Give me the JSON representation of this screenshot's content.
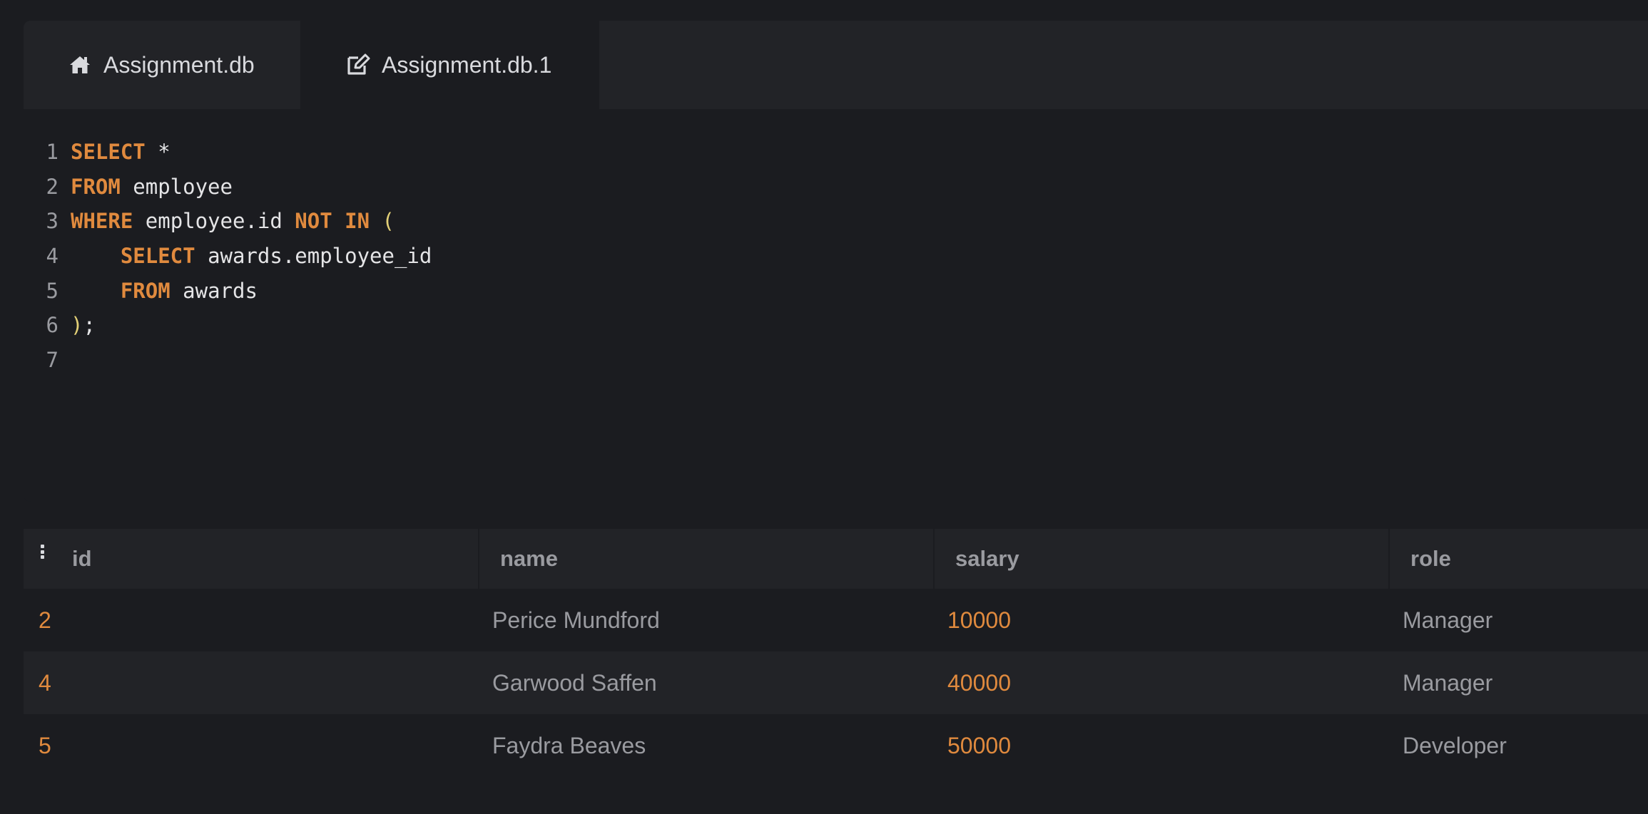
{
  "tabs": [
    {
      "label": "Assignment.db",
      "icon": "home-icon"
    },
    {
      "label": "Assignment.db.1",
      "icon": "edit-icon"
    }
  ],
  "editor": {
    "line_numbers": [
      "1",
      "2",
      "3",
      "4",
      "5",
      "6",
      "7"
    ],
    "tokens": {
      "l1_kw": "SELECT",
      "l1_rest": " *",
      "l2_kw": "FROM",
      "l2_rest": " employee",
      "l3_kw": "WHERE",
      "l3_mid": " employee.id ",
      "l3_kw2": "NOT IN",
      "l3_paren": "(",
      "l4_indent": "    ",
      "l4_kw": "SELECT",
      "l4_rest": " awards.employee_id",
      "l5_indent": "    ",
      "l5_kw": "FROM",
      "l5_rest": " awards",
      "l6_paren": ")",
      "l6_rest": ";"
    }
  },
  "results": {
    "columns": [
      "id",
      "name",
      "salary",
      "role"
    ],
    "rows": [
      {
        "id": "2",
        "name": "Perice Mundford",
        "salary": "10000",
        "role": "Manager"
      },
      {
        "id": "4",
        "name": "Garwood Saffen",
        "salary": "40000",
        "role": "Manager"
      },
      {
        "id": "5",
        "name": "Faydra Beaves",
        "salary": "50000",
        "role": "Developer"
      }
    ]
  },
  "colors": {
    "background": "#1b1c20",
    "panel": "#222327",
    "keyword": "#e08a3e",
    "paren": "#e3d077",
    "text": "#e4e4e6",
    "muted": "#9a9ba0"
  }
}
